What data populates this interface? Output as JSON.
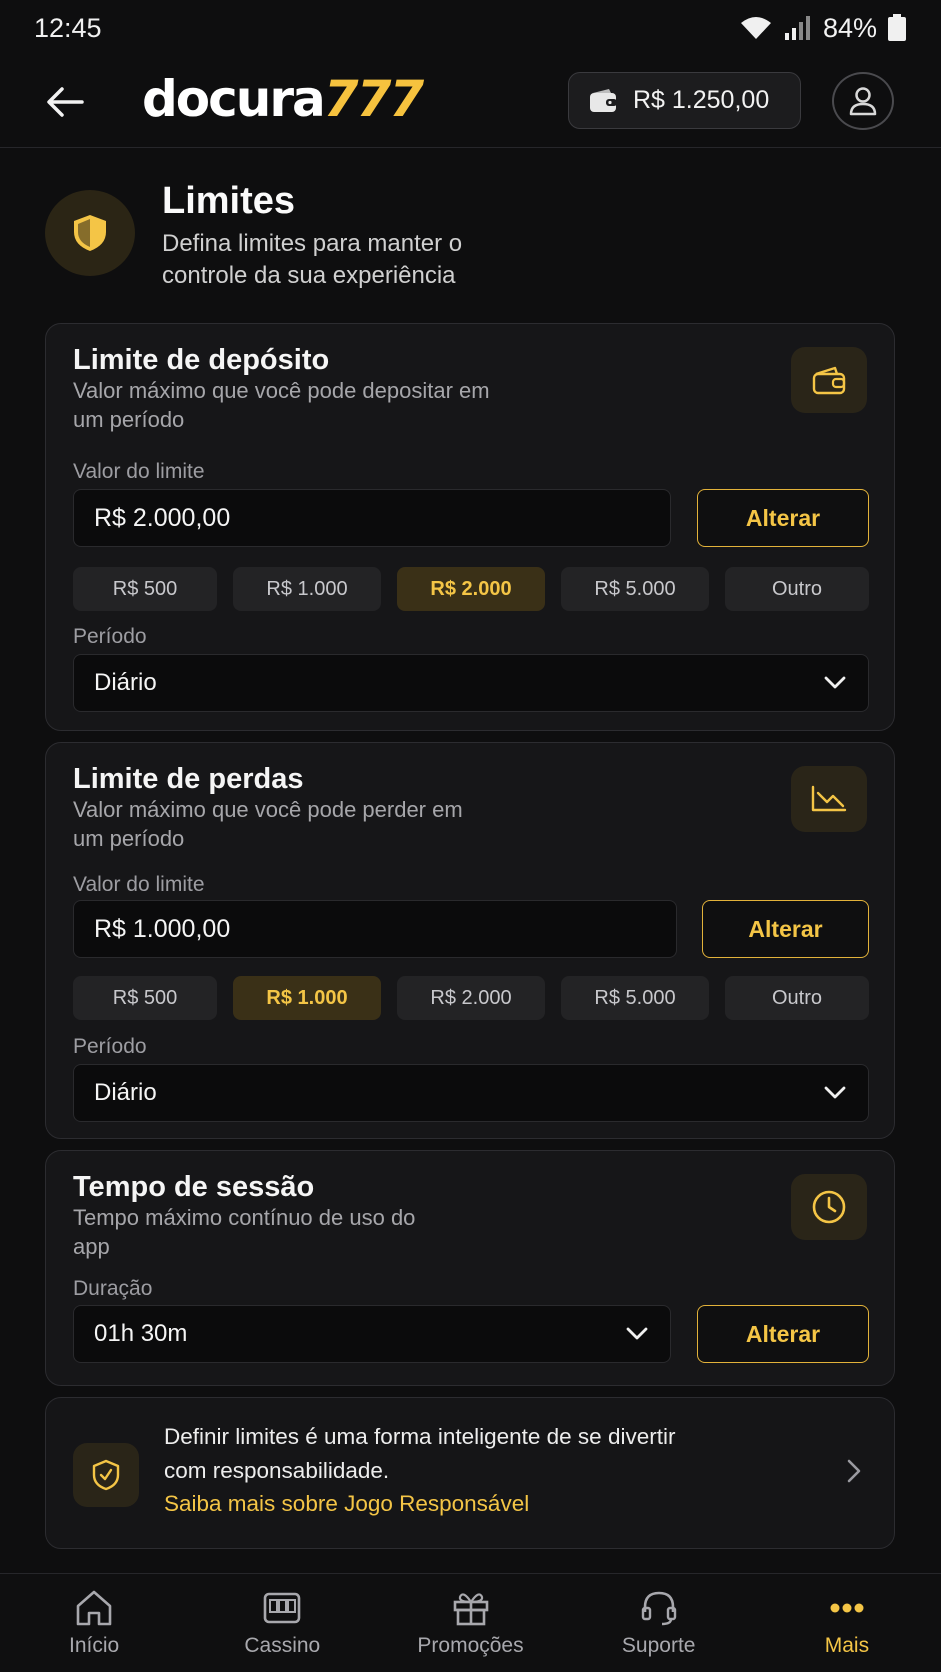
{
  "status_bar": {
    "time": "12:45",
    "battery": "84%"
  },
  "header": {
    "logo_main": "docura",
    "logo_accent": "777",
    "balance": "R$ 1.250,00"
  },
  "page": {
    "title": "Limites",
    "subtitle": "Defina limites para manter o controle da sua experiência"
  },
  "deposit": {
    "title": "Limite de depósito",
    "desc": "Valor máximo que você pode depositar em um período",
    "value_label": "Valor do limite",
    "value": "R$ 2.000,00",
    "button": "Alterar",
    "chips": [
      "R$ 500",
      "R$ 1.000",
      "R$ 2.000",
      "R$ 5.000",
      "Outro"
    ],
    "selected_chip": 2,
    "period_label": "Período",
    "period": "Diário"
  },
  "losses": {
    "title": "Limite de perdas",
    "desc": "Valor máximo que você pode perder em um período",
    "value_label": "Valor do limite",
    "value": "R$ 1.000,00",
    "button": "Alterar",
    "chips": [
      "R$ 500",
      "R$ 1.000",
      "R$ 2.000",
      "R$ 5.000",
      "Outro"
    ],
    "selected_chip": 1,
    "period_label": "Período",
    "period": "Diário"
  },
  "session": {
    "title": "Tempo de sessão",
    "desc": "Tempo máximo contínuo de uso do app",
    "duration_label": "Duração",
    "duration": "01h 30m",
    "button": "Alterar"
  },
  "info": {
    "text": "Definir limites é uma forma inteligente de se divertir com responsabilidade.",
    "link": "Saiba mais sobre Jogo Responsável"
  },
  "bottom_nav": {
    "items": [
      {
        "label": "Início",
        "icon": "home-icon"
      },
      {
        "label": "Cassino",
        "icon": "slot-machine-icon"
      },
      {
        "label": "Promoções",
        "icon": "gift-icon"
      },
      {
        "label": "Suporte",
        "icon": "headset-icon"
      },
      {
        "label": "Mais",
        "icon": "more-dots-icon"
      }
    ],
    "active_index": 4
  },
  "colors": {
    "accent": "#f4c546",
    "background": "#0e0e0f",
    "card": "#161618"
  }
}
